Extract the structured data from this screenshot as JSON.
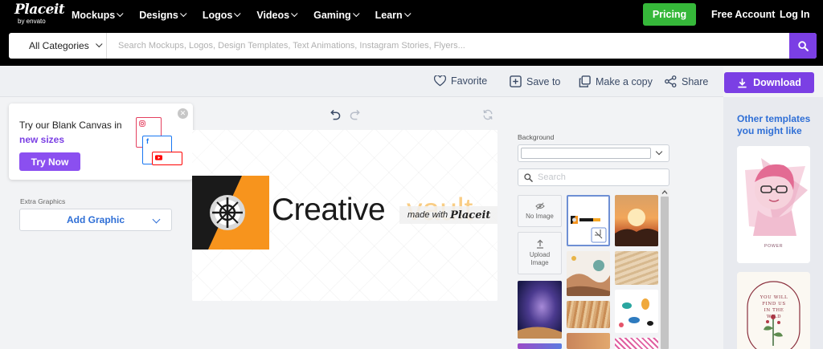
{
  "brand": {
    "name": "Placeit",
    "sub": "by envato"
  },
  "nav": {
    "items": [
      "Mockups",
      "Designs",
      "Logos",
      "Videos",
      "Gaming",
      "Learn"
    ],
    "pricing": "Pricing",
    "free_account": "Free Account",
    "login": "Log In"
  },
  "search": {
    "category": "All Categories",
    "placeholder": "Search Mockups, Logos, Design Templates, Text Animations, Instagram Stories, Flyers..."
  },
  "actions": {
    "favorite": "Favorite",
    "save_to": "Save to",
    "make_copy": "Make a copy",
    "share": "Share",
    "download": "Download"
  },
  "promo": {
    "line1": "Try our Blank Canvas in",
    "line2": "new sizes",
    "button": "Try Now"
  },
  "extra_graphics": {
    "label": "Extra Graphics",
    "button": "Add Graphic"
  },
  "preview": {
    "logo_text": "Creative",
    "logo_text_orange": "vault",
    "watermark_prefix": "made with",
    "watermark_brand": "Placeit"
  },
  "background": {
    "label": "Background",
    "search_placeholder": "Search",
    "no_image": "No Image",
    "upload_image": "Upload Image"
  },
  "sidebar": {
    "title": "Other templates you might like",
    "tmpl1_caption": "POWER",
    "tmpl2_text": "YOU WILL FIND US IN THE WILD"
  },
  "colors": {
    "accent_purple": "#7b3fe4",
    "pricing_green": "#36b83a",
    "link_blue": "#2f6fd6",
    "logo_orange": "#f5a623"
  }
}
